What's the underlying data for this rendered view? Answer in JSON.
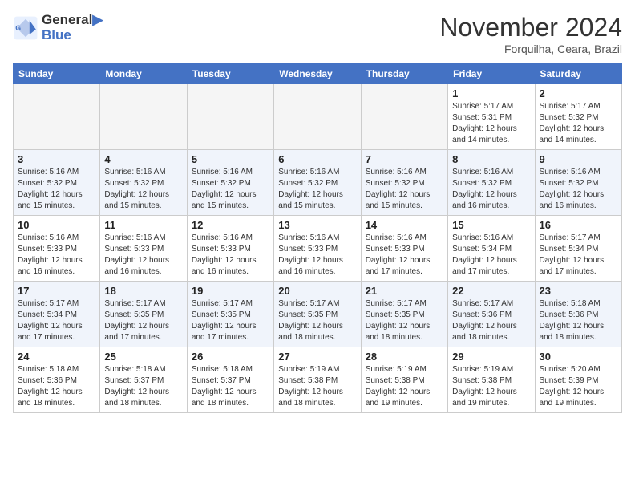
{
  "header": {
    "logo_line1": "General",
    "logo_line2": "Blue",
    "month": "November 2024",
    "location": "Forquilha, Ceara, Brazil"
  },
  "weekdays": [
    "Sunday",
    "Monday",
    "Tuesday",
    "Wednesday",
    "Thursday",
    "Friday",
    "Saturday"
  ],
  "weeks": [
    [
      {
        "day": "",
        "info": ""
      },
      {
        "day": "",
        "info": ""
      },
      {
        "day": "",
        "info": ""
      },
      {
        "day": "",
        "info": ""
      },
      {
        "day": "",
        "info": ""
      },
      {
        "day": "1",
        "info": "Sunrise: 5:17 AM\nSunset: 5:31 PM\nDaylight: 12 hours\nand 14 minutes."
      },
      {
        "day": "2",
        "info": "Sunrise: 5:17 AM\nSunset: 5:32 PM\nDaylight: 12 hours\nand 14 minutes."
      }
    ],
    [
      {
        "day": "3",
        "info": "Sunrise: 5:16 AM\nSunset: 5:32 PM\nDaylight: 12 hours\nand 15 minutes."
      },
      {
        "day": "4",
        "info": "Sunrise: 5:16 AM\nSunset: 5:32 PM\nDaylight: 12 hours\nand 15 minutes."
      },
      {
        "day": "5",
        "info": "Sunrise: 5:16 AM\nSunset: 5:32 PM\nDaylight: 12 hours\nand 15 minutes."
      },
      {
        "day": "6",
        "info": "Sunrise: 5:16 AM\nSunset: 5:32 PM\nDaylight: 12 hours\nand 15 minutes."
      },
      {
        "day": "7",
        "info": "Sunrise: 5:16 AM\nSunset: 5:32 PM\nDaylight: 12 hours\nand 15 minutes."
      },
      {
        "day": "8",
        "info": "Sunrise: 5:16 AM\nSunset: 5:32 PM\nDaylight: 12 hours\nand 16 minutes."
      },
      {
        "day": "9",
        "info": "Sunrise: 5:16 AM\nSunset: 5:32 PM\nDaylight: 12 hours\nand 16 minutes."
      }
    ],
    [
      {
        "day": "10",
        "info": "Sunrise: 5:16 AM\nSunset: 5:33 PM\nDaylight: 12 hours\nand 16 minutes."
      },
      {
        "day": "11",
        "info": "Sunrise: 5:16 AM\nSunset: 5:33 PM\nDaylight: 12 hours\nand 16 minutes."
      },
      {
        "day": "12",
        "info": "Sunrise: 5:16 AM\nSunset: 5:33 PM\nDaylight: 12 hours\nand 16 minutes."
      },
      {
        "day": "13",
        "info": "Sunrise: 5:16 AM\nSunset: 5:33 PM\nDaylight: 12 hours\nand 16 minutes."
      },
      {
        "day": "14",
        "info": "Sunrise: 5:16 AM\nSunset: 5:33 PM\nDaylight: 12 hours\nand 17 minutes."
      },
      {
        "day": "15",
        "info": "Sunrise: 5:16 AM\nSunset: 5:34 PM\nDaylight: 12 hours\nand 17 minutes."
      },
      {
        "day": "16",
        "info": "Sunrise: 5:17 AM\nSunset: 5:34 PM\nDaylight: 12 hours\nand 17 minutes."
      }
    ],
    [
      {
        "day": "17",
        "info": "Sunrise: 5:17 AM\nSunset: 5:34 PM\nDaylight: 12 hours\nand 17 minutes."
      },
      {
        "day": "18",
        "info": "Sunrise: 5:17 AM\nSunset: 5:35 PM\nDaylight: 12 hours\nand 17 minutes."
      },
      {
        "day": "19",
        "info": "Sunrise: 5:17 AM\nSunset: 5:35 PM\nDaylight: 12 hours\nand 17 minutes."
      },
      {
        "day": "20",
        "info": "Sunrise: 5:17 AM\nSunset: 5:35 PM\nDaylight: 12 hours\nand 18 minutes."
      },
      {
        "day": "21",
        "info": "Sunrise: 5:17 AM\nSunset: 5:35 PM\nDaylight: 12 hours\nand 18 minutes."
      },
      {
        "day": "22",
        "info": "Sunrise: 5:17 AM\nSunset: 5:36 PM\nDaylight: 12 hours\nand 18 minutes."
      },
      {
        "day": "23",
        "info": "Sunrise: 5:18 AM\nSunset: 5:36 PM\nDaylight: 12 hours\nand 18 minutes."
      }
    ],
    [
      {
        "day": "24",
        "info": "Sunrise: 5:18 AM\nSunset: 5:36 PM\nDaylight: 12 hours\nand 18 minutes."
      },
      {
        "day": "25",
        "info": "Sunrise: 5:18 AM\nSunset: 5:37 PM\nDaylight: 12 hours\nand 18 minutes."
      },
      {
        "day": "26",
        "info": "Sunrise: 5:18 AM\nSunset: 5:37 PM\nDaylight: 12 hours\nand 18 minutes."
      },
      {
        "day": "27",
        "info": "Sunrise: 5:19 AM\nSunset: 5:38 PM\nDaylight: 12 hours\nand 18 minutes."
      },
      {
        "day": "28",
        "info": "Sunrise: 5:19 AM\nSunset: 5:38 PM\nDaylight: 12 hours\nand 19 minutes."
      },
      {
        "day": "29",
        "info": "Sunrise: 5:19 AM\nSunset: 5:38 PM\nDaylight: 12 hours\nand 19 minutes."
      },
      {
        "day": "30",
        "info": "Sunrise: 5:20 AM\nSunset: 5:39 PM\nDaylight: 12 hours\nand 19 minutes."
      }
    ]
  ]
}
